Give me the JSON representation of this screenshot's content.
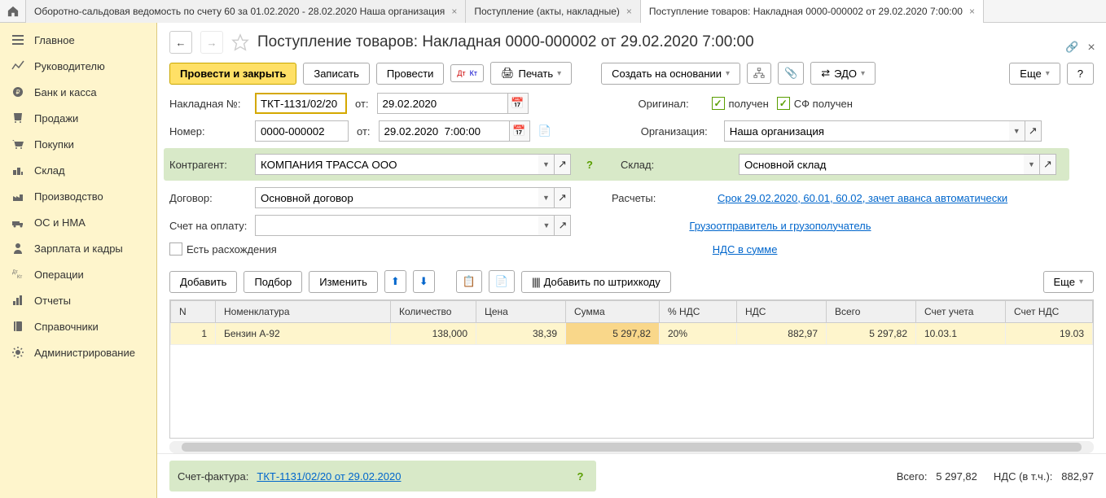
{
  "tabs": [
    {
      "label": "Оборотно-сальдовая ведомость по счету 60 за 01.02.2020 - 28.02.2020 Наша организация",
      "active": false
    },
    {
      "label": "Поступление (акты, накладные)",
      "active": false
    },
    {
      "label": "Поступление товаров: Накладная 0000-000002 от 29.02.2020 7:00:00",
      "active": true
    }
  ],
  "sidebar": {
    "items": [
      {
        "label": "Главное",
        "icon": "home"
      },
      {
        "label": "Руководителю",
        "icon": "chart"
      },
      {
        "label": "Банк и касса",
        "icon": "coin"
      },
      {
        "label": "Продажи",
        "icon": "bag"
      },
      {
        "label": "Покупки",
        "icon": "cart"
      },
      {
        "label": "Склад",
        "icon": "warehouse"
      },
      {
        "label": "Производство",
        "icon": "factory"
      },
      {
        "label": "ОС и НМА",
        "icon": "truck"
      },
      {
        "label": "Зарплата и кадры",
        "icon": "person"
      },
      {
        "label": "Операции",
        "icon": "ledger"
      },
      {
        "label": "Отчеты",
        "icon": "bars"
      },
      {
        "label": "Справочники",
        "icon": "book"
      },
      {
        "label": "Администрирование",
        "icon": "gear"
      }
    ]
  },
  "header": {
    "title": "Поступление товаров: Накладная 0000-000002 от 29.02.2020 7:00:00"
  },
  "toolbar": {
    "post_close": "Провести и закрыть",
    "save": "Записать",
    "post": "Провести",
    "print": "Печать",
    "create_based": "Создать на основании",
    "edo": "ЭДО",
    "more": "Еще",
    "help": "?"
  },
  "form": {
    "invoice_no_label": "Накладная №:",
    "invoice_no": "ТКТ-1131/02/20",
    "from_label": "от:",
    "invoice_date": "29.02.2020",
    "number_label": "Номер:",
    "number": "0000-000002",
    "number_date": "29.02.2020  7:00:00",
    "original_label": "Оригинал:",
    "received": "получен",
    "sf_received": "СФ получен",
    "org_label": "Организация:",
    "org": "Наша организация",
    "contractor_label": "Контрагент:",
    "contractor": "КОМПАНИЯ ТРАССА ООО",
    "warehouse_label": "Склад:",
    "warehouse": "Основной склад",
    "contract_label": "Договор:",
    "contract": "Основной договор",
    "calc_label": "Расчеты:",
    "calc_link": "Срок 29.02.2020, 60.01, 60.02, зачет аванса автоматически",
    "payment_invoice_label": "Счет на оплату:",
    "shipper_link": "Грузоотправитель и грузополучатель",
    "vat_link": "НДС в сумме",
    "discrepancy": "Есть расхождения"
  },
  "table_toolbar": {
    "add": "Добавить",
    "pick": "Подбор",
    "edit": "Изменить",
    "barcode": "Добавить по штрихкоду",
    "more": "Еще"
  },
  "table": {
    "headers": {
      "n": "N",
      "nomenclature": "Номенклатура",
      "qty": "Количество",
      "price": "Цена",
      "sum": "Сумма",
      "vat_pct": "% НДС",
      "vat": "НДС",
      "total": "Всего",
      "account": "Счет учета",
      "vat_account": "Счет НДС"
    },
    "rows": [
      {
        "n": "1",
        "nomenclature": "Бензин А-92",
        "qty": "138,000",
        "price": "38,39",
        "sum": "5 297,82",
        "vat_pct": "20%",
        "vat": "882,97",
        "total": "5 297,82",
        "account": "10.03.1",
        "vat_account": "19.03"
      }
    ]
  },
  "footer": {
    "sf_label": "Счет-фактура:",
    "sf_value": "ТКТ-1131/02/20 от 29.02.2020",
    "total_label": "Всего:",
    "total": "5 297,82",
    "vat_label": "НДС (в т.ч.):",
    "vat": "882,97"
  }
}
